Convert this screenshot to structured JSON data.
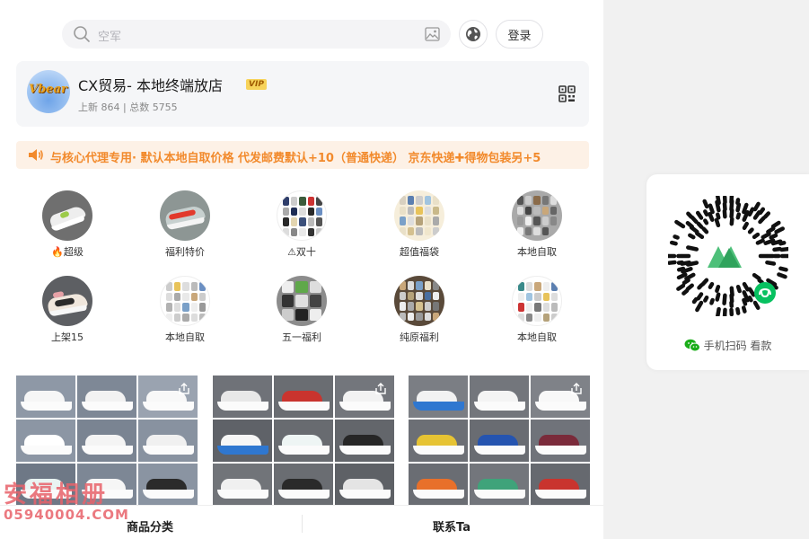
{
  "search": {
    "placeholder": "空军"
  },
  "header": {
    "login_label": "登录"
  },
  "store": {
    "avatar_text": "Vbear",
    "name": "CX贸易- 本地终端放店",
    "vip_badge": "VIP",
    "stats": "上新 864 | 总数 5755"
  },
  "notice": {
    "text": "与核心代理专用· 默认本地自取价格 代发邮费默认+10（普通快递） 京东快递✚得物包装另+5"
  },
  "categories": [
    {
      "label": "🔥超级"
    },
    {
      "label": "福利特价"
    },
    {
      "label": "⚠双十"
    },
    {
      "label": "超值福袋"
    },
    {
      "label": "本地自取"
    },
    {
      "label": "上架15"
    },
    {
      "label": "本地自取"
    },
    {
      "label": "五一福利"
    },
    {
      "label": "纯原福利"
    },
    {
      "label": "本地自取"
    }
  ],
  "bottom_bar": {
    "left_label": "商品分类",
    "right_label": "联系Ta"
  },
  "watermark": {
    "line1": "安福相册",
    "line2": "05940004.COM"
  },
  "side_panel": {
    "scan_text": "手机扫码 看款"
  },
  "colors": {
    "notice_text": "#f28a2c",
    "vip_bg": "#f7d35a",
    "wechat_green": "#1aad19",
    "mini_program_green": "#07c160"
  }
}
